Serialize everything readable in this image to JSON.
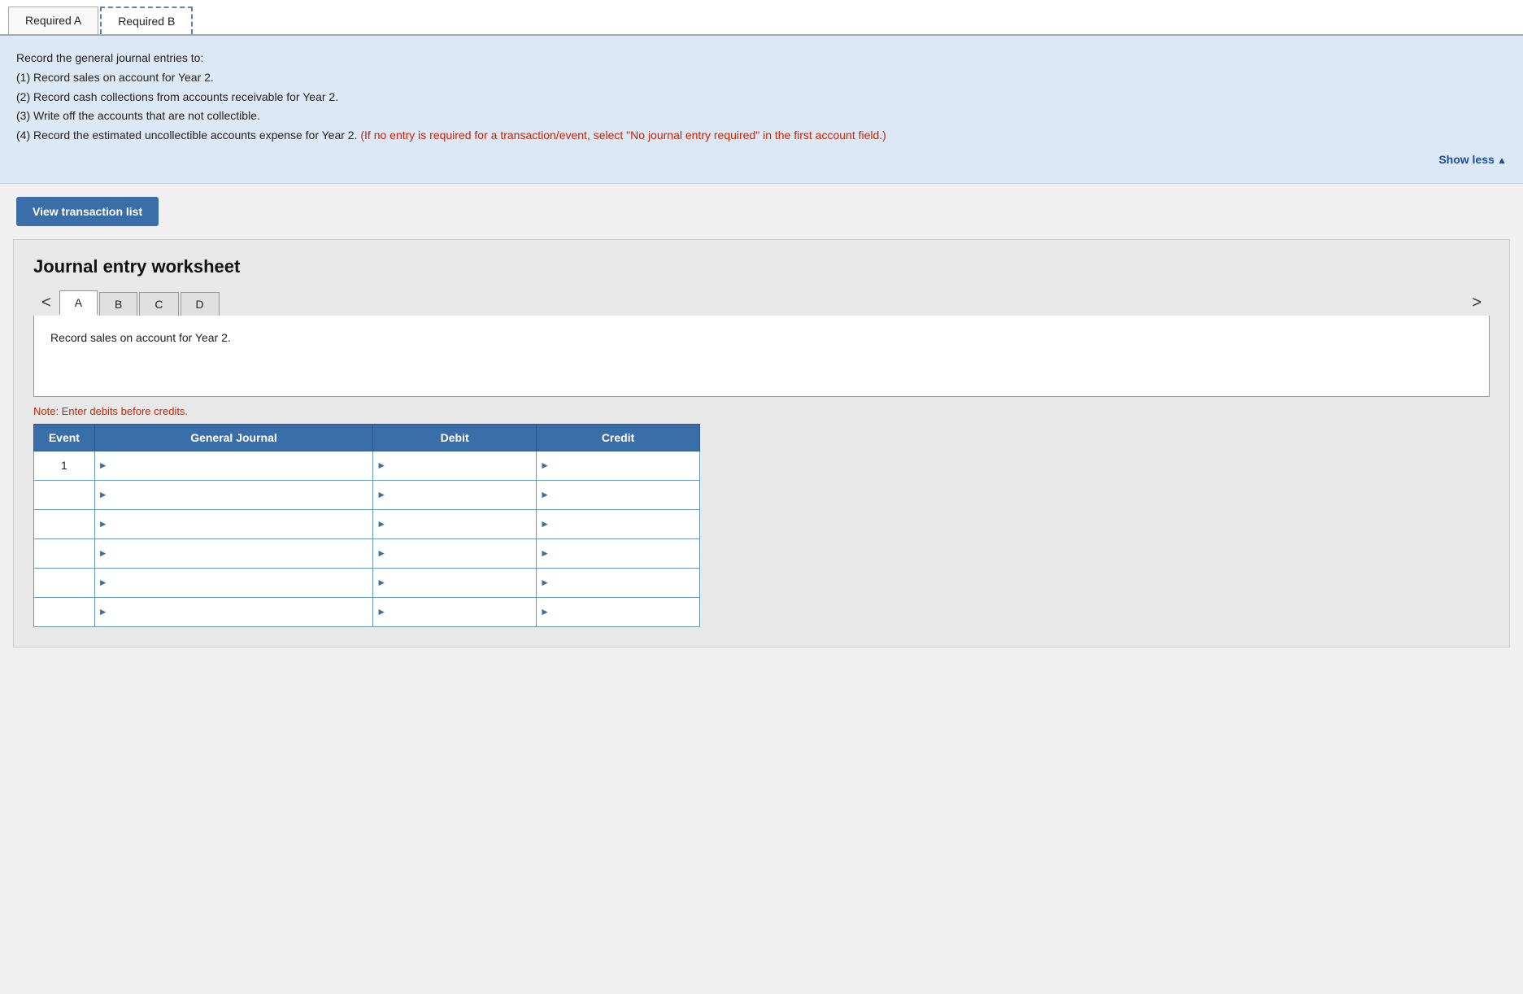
{
  "tabs": {
    "items": [
      {
        "label": "Required A",
        "active": false
      },
      {
        "label": "Required B",
        "active": true
      }
    ]
  },
  "instructions": {
    "title": "Record the general journal entries to:",
    "items": [
      "(1) Record sales on account for Year 2.",
      "(2) Record cash collections from accounts receivable for Year 2.",
      "(3) Write off the accounts that are not collectible.",
      "(4) Record the estimated uncollectible accounts expense for Year 2."
    ],
    "red_note": "(If no entry is required for a transaction/event, select \"No journal entry required\" in the first account field.)",
    "show_less_label": "Show less"
  },
  "view_transaction_button": "View transaction list",
  "worksheet": {
    "title": "Journal entry worksheet",
    "entry_tabs": [
      {
        "label": "A",
        "active": true
      },
      {
        "label": "B",
        "active": false
      },
      {
        "label": "C",
        "active": false
      },
      {
        "label": "D",
        "active": false
      }
    ],
    "description": "Record sales on account for Year 2.",
    "note": "Note: Enter debits before credits.",
    "table": {
      "headers": [
        "Event",
        "General Journal",
        "Debit",
        "Credit"
      ],
      "rows": [
        {
          "event": "1",
          "gj": "",
          "debit": "",
          "credit": ""
        },
        {
          "event": "",
          "gj": "",
          "debit": "",
          "credit": ""
        },
        {
          "event": "",
          "gj": "",
          "debit": "",
          "credit": ""
        },
        {
          "event": "",
          "gj": "",
          "debit": "",
          "credit": ""
        },
        {
          "event": "",
          "gj": "",
          "debit": "",
          "credit": ""
        },
        {
          "event": "",
          "gj": "",
          "debit": "",
          "credit": ""
        }
      ]
    }
  },
  "nav": {
    "prev": "<",
    "next": ">"
  }
}
